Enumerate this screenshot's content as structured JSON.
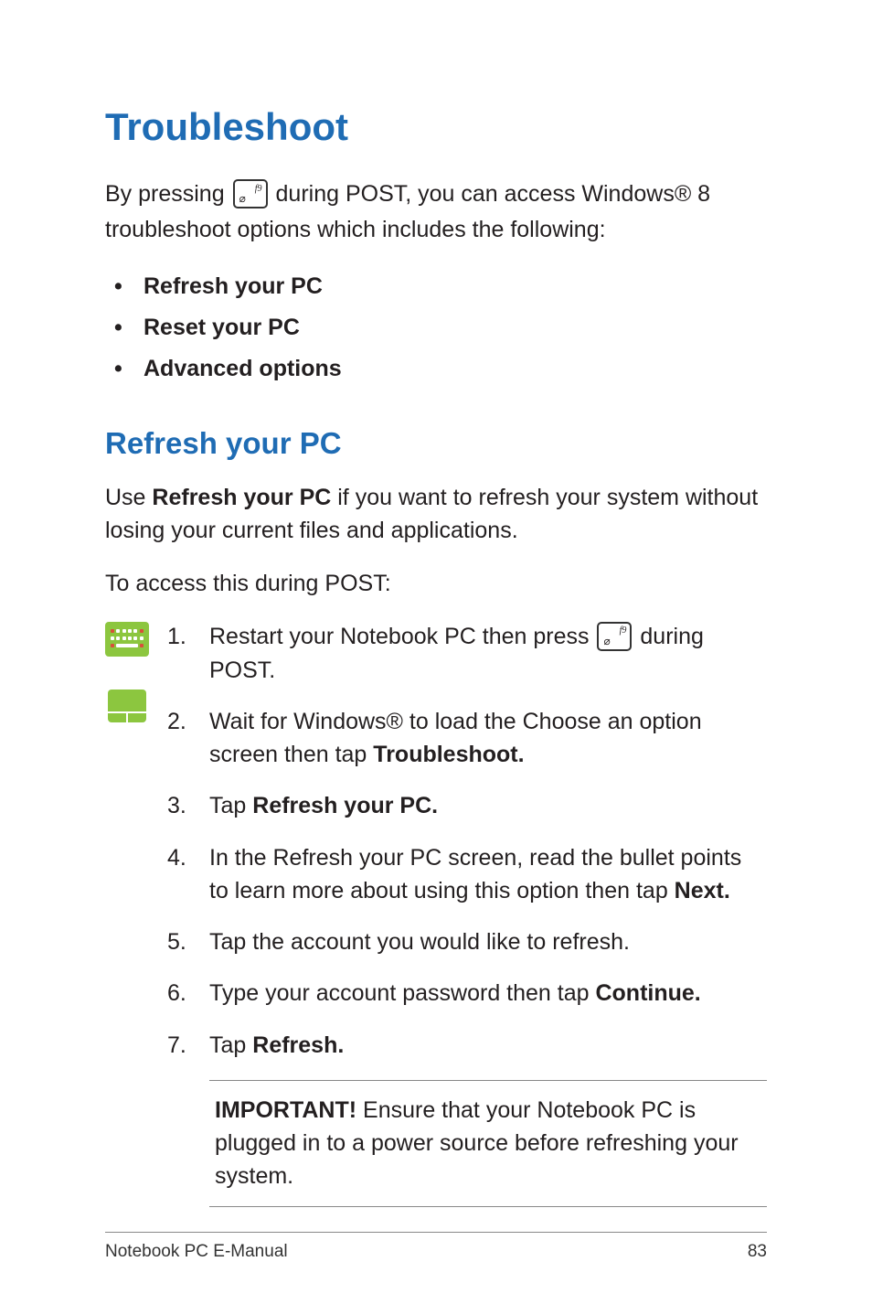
{
  "heading": "Troubleshoot",
  "intro": {
    "part1": "By pressing ",
    "keylabel": "f9",
    "part2": " during POST, you can access Windows® 8 troubleshoot options which includes the following:"
  },
  "bullets": [
    "Refresh your PC",
    "Reset your PC",
    "Advanced options"
  ],
  "subheading": "Refresh your PC",
  "sub_intro": {
    "prefix": "Use ",
    "bold": "Refresh your PC",
    "suffix": " if you want to refresh your system without losing your current files and applications."
  },
  "access_line": "To access this during POST:",
  "steps": {
    "s1": {
      "a": "Restart your Notebook PC then press ",
      "keylabel": "f9",
      "b": " during POST."
    },
    "s2": {
      "a": "Wait for Windows® to load the Choose an option screen then tap ",
      "bold": "Troubleshoot."
    },
    "s3": {
      "a": "Tap ",
      "bold": "Refresh your PC."
    },
    "s4": {
      "a": "In the Refresh your PC screen, read the bullet points to learn more about using this option then tap ",
      "bold": "Next."
    },
    "s5": "Tap the account you would like to refresh.",
    "s6": {
      "a": "Type your account password then tap ",
      "bold": "Continue."
    },
    "s7": {
      "a": "Tap ",
      "bold": "Refresh."
    }
  },
  "important": {
    "label": "IMPORTANT!",
    "text": " Ensure that your Notebook PC is plugged in to a power source before refreshing your system."
  },
  "footer": {
    "left": "Notebook PC E-Manual",
    "right": "83"
  }
}
